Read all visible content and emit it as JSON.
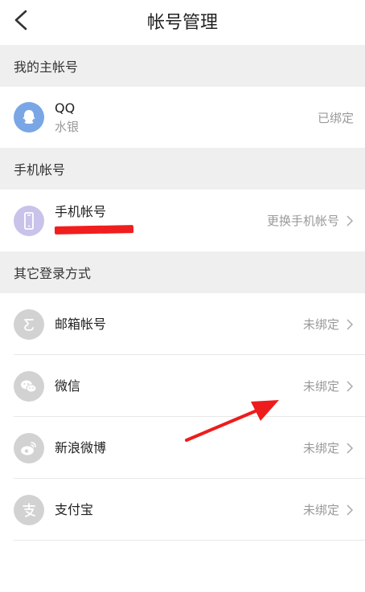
{
  "header": {
    "title": "帐号管理"
  },
  "sections": {
    "primary": "我的主帐号",
    "phone": "手机帐号",
    "other": "其它登录方式"
  },
  "qq_row": {
    "name": "QQ",
    "nickname": "水银",
    "status": "已绑定"
  },
  "phone_row": {
    "name": "手机帐号",
    "action": "更换手机帐号"
  },
  "other_rows": [
    {
      "name": "邮箱帐号",
      "status": "未绑定",
      "icon": "email-icon"
    },
    {
      "name": "微信",
      "status": "未绑定",
      "icon": "wechat-icon"
    },
    {
      "name": "新浪微博",
      "status": "未绑定",
      "icon": "weibo-icon"
    },
    {
      "name": "支付宝",
      "status": "未绑定",
      "icon": "alipay-icon"
    }
  ],
  "colors": {
    "annotation_arrow": "#ee1c1c",
    "qq_icon_bg": "#7aa6e6",
    "phone_icon_bg": "#c8c3ea"
  }
}
